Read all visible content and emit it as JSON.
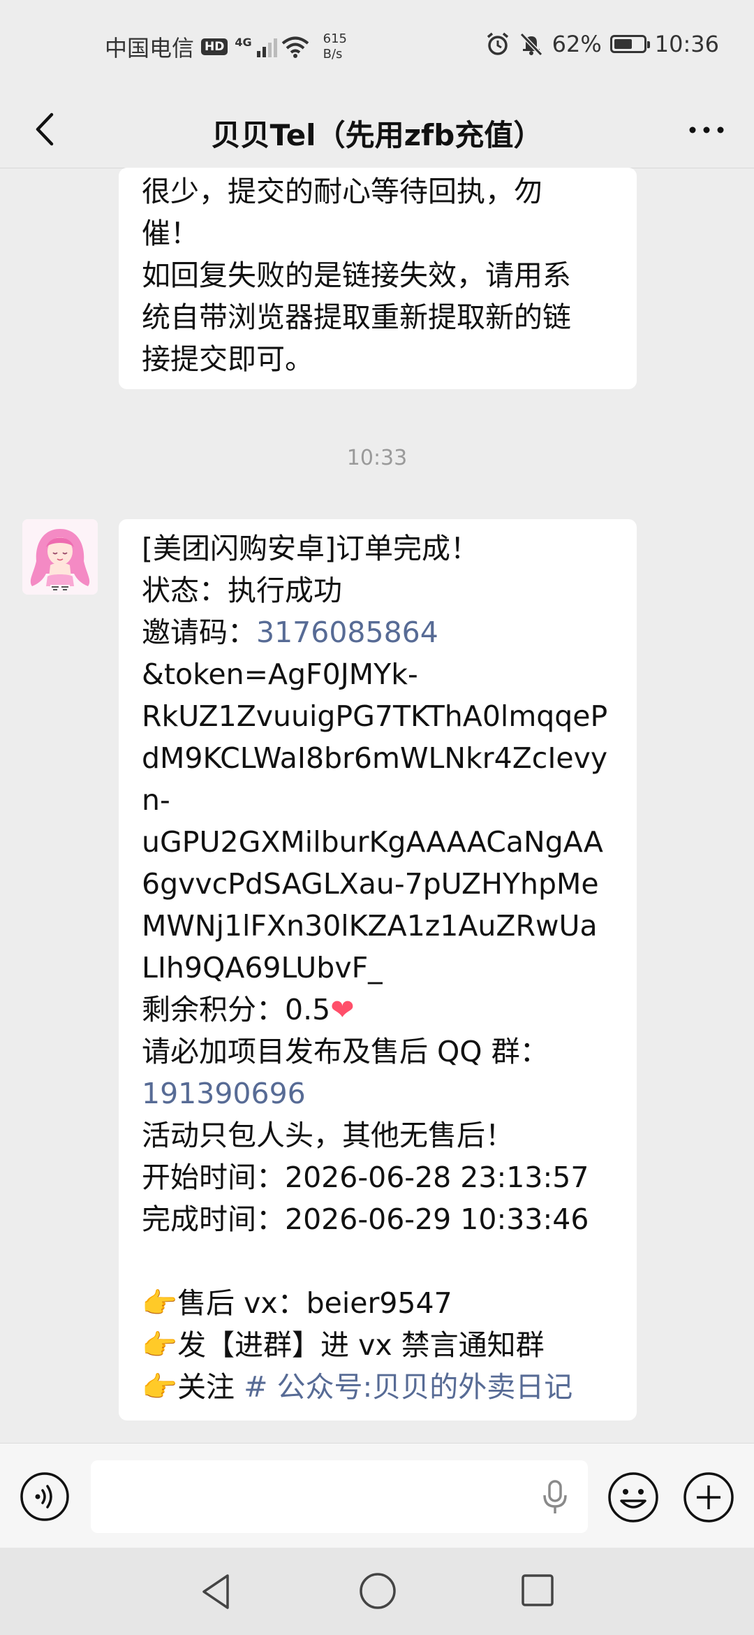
{
  "status_bar": {
    "carrier": "中国电信",
    "hd": "HD",
    "network": "4G",
    "speed_value": "615",
    "speed_unit": "B/s",
    "battery_percent": "62%",
    "battery_level": 0.62,
    "time": "10:36",
    "icons": [
      "alarm-icon",
      "mute-icon",
      "wifi-icon",
      "signal-icon"
    ]
  },
  "header": {
    "title": "贝贝Tel（先用zfb充值）",
    "back_icon": "chevron-left-icon",
    "more_icon": "more-dots-icon"
  },
  "messages": {
    "first": {
      "lines": [
        "很少，提交的耐心等待回执，勿",
        "催！",
        "如回复失败的是链接失效，请用系",
        "统自带浏览器提取重新提取新的链",
        "接提交即可。"
      ]
    },
    "timestamp": "10:33",
    "second": {
      "line1": "[美团闪购安卓]订单完成！",
      "line2": "状态：执行成功",
      "invite_label": "邀请码：",
      "invite_code": "3176085864",
      "token_lines": [
        "&token=AgF0JMYk-",
        "RkUZ1ZvuuigPG7TKThA0lmqqeP",
        "dM9KCLWaI8br6mWLNkr4ZcIevy",
        "n-",
        "uGPU2GXMilburKgAAAACaNgAA",
        "6gvvcPdSAGLXau-7pUZHYhpMe",
        "MWNj1lFXn30lKZA1z1AuZRwUa",
        "LIh9QA69LUbvF_"
      ],
      "points_label": "剩余积分：0.5",
      "heart": "❤",
      "group_line": "请必加项目发布及售后 QQ 群：",
      "group_number": "191390696",
      "notice": "活动只包人头，其他无售后！",
      "start_time": "开始时间：2026-06-28 23:13:57",
      "finish_time": "完成时间：2026-06-29 10:33:46",
      "pointer": "👉",
      "after_sales": "售后 vx：beier9547",
      "join_group": "发【进群】进 vx 禁言通知群",
      "follow_prefix": "关注 ",
      "follow_link": "# 公众号:贝贝的外卖日记"
    }
  },
  "input_bar": {
    "voice_icon": "voice-icon",
    "placeholder": "",
    "mic_icon": "mic-icon",
    "emoji_icon": "emoji-icon",
    "plus_icon": "plus-circle-icon"
  },
  "nav_bar": {
    "icons": [
      "nav-back-icon",
      "nav-home-icon",
      "nav-recents-icon"
    ]
  }
}
